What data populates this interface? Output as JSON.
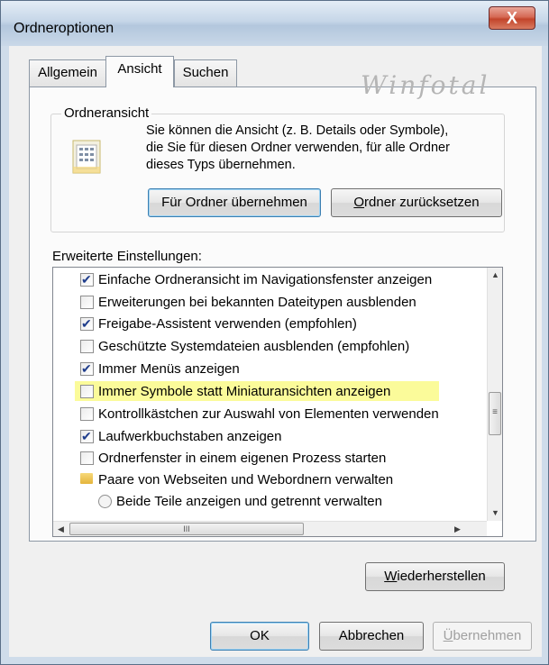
{
  "window": {
    "title": "Ordneroptionen",
    "close_glyph": "X"
  },
  "tabs": [
    {
      "label": "Allgemein",
      "active": false
    },
    {
      "label": "Ansicht",
      "active": true
    },
    {
      "label": "Suchen",
      "active": false
    }
  ],
  "watermark": "Winfotal",
  "folder_view": {
    "group_label": "Ordneransicht",
    "description_lines": [
      "Sie können die Ansicht (z. B. Details oder Symbole),",
      "die Sie für diesen Ordner verwenden, für alle Ordner",
      "dieses Typs übernehmen."
    ],
    "apply_button": "Für Ordner übernehmen",
    "reset_button": {
      "mnemonic": "O",
      "rest": "rdner zurücksetzen"
    }
  },
  "advanced": {
    "label": "Erweiterte Einstellungen:",
    "items": [
      {
        "type": "checkbox",
        "checked": true,
        "label": "Einfache Ordneransicht im Navigationsfenster anzeigen"
      },
      {
        "type": "checkbox",
        "checked": false,
        "label": "Erweiterungen bei bekannten Dateitypen ausblenden"
      },
      {
        "type": "checkbox",
        "checked": true,
        "label": "Freigabe-Assistent verwenden (empfohlen)"
      },
      {
        "type": "checkbox",
        "checked": false,
        "label": "Geschützte Systemdateien ausblenden (empfohlen)"
      },
      {
        "type": "checkbox",
        "checked": true,
        "label": "Immer Menüs anzeigen"
      },
      {
        "type": "checkbox",
        "checked": false,
        "label": "Immer Symbole statt Miniaturansichten anzeigen",
        "highlighted": true
      },
      {
        "type": "checkbox",
        "checked": false,
        "label": "Kontrollkästchen zur Auswahl von Elementen verwenden"
      },
      {
        "type": "checkbox",
        "checked": true,
        "label": "Laufwerkbuchstaben anzeigen"
      },
      {
        "type": "checkbox",
        "checked": false,
        "label": "Ordnerfenster in einem eigenen Prozess starten"
      },
      {
        "type": "folder",
        "label": "Paare von Webseiten und Webordnern verwalten"
      },
      {
        "type": "radio",
        "label": "Beide Teile anzeigen und getrennt verwalten"
      }
    ],
    "hscroll_thumb_grip": "III",
    "vscroll_thumb_grip": "≡"
  },
  "buttons": {
    "restore": {
      "mnemonic": "W",
      "rest": "iederherstellen"
    },
    "ok": "OK",
    "cancel": "Abbrechen",
    "apply": {
      "mnemonic": "Ü",
      "rest": "bernehmen",
      "enabled": false
    }
  }
}
